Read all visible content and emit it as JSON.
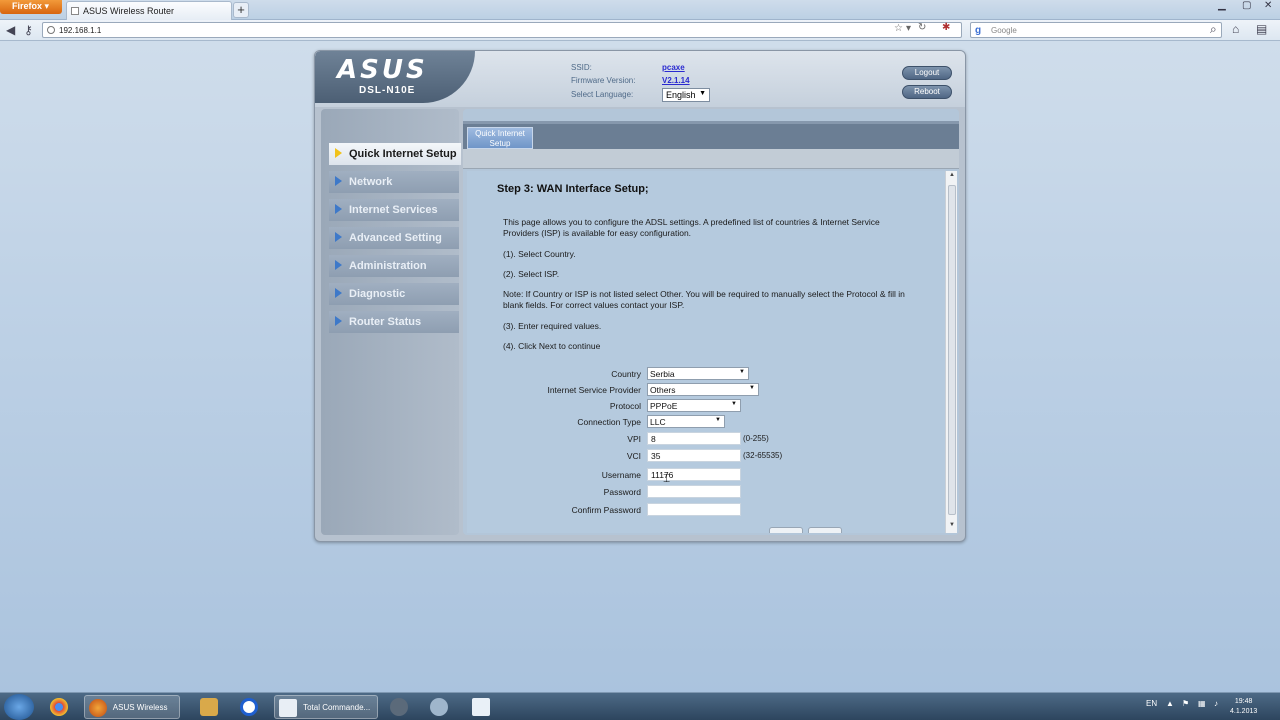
{
  "browser": {
    "app_button": "Firefox",
    "tab_title": "ASUS Wireless Router",
    "new_tab": "+",
    "url": "192.168.1.1",
    "search_placeholder": "Google"
  },
  "router": {
    "brand": "ASUS",
    "model": "DSL-N10E",
    "ssid_label": "SSID:",
    "ssid_value": "pcaxe",
    "firmware_label": "Firmware Version:",
    "firmware_value": "V2.1.14",
    "language_label": "Select Language:",
    "language_value": "English",
    "logout": "Logout",
    "reboot": "Reboot"
  },
  "sidebar": {
    "items": [
      {
        "label": "Quick Internet Setup"
      },
      {
        "label": "Network"
      },
      {
        "label": "Internet Services"
      },
      {
        "label": "Advanced Setting"
      },
      {
        "label": "Administration"
      },
      {
        "label": "Diagnostic"
      },
      {
        "label": "Router Status"
      }
    ]
  },
  "main": {
    "tab_line1": "Quick Internet",
    "tab_line2": "Setup",
    "step_title": "Step 3: WAN Interface Setup;",
    "intro": "This page allows you to configure the ADSL settings. A predefined list of countries & Internet Service Providers (ISP) is available for easy configuration.",
    "step1": "(1). Select Country.",
    "step2": "(2). Select ISP.",
    "note": "Note: If Country or ISP is not listed select Other. You will be required to manually select the Protocol & fill in blank fields. For correct values contact your ISP.",
    "step3": "(3). Enter required values.",
    "step4": "(4). Click Next to continue"
  },
  "form": {
    "country_label": "Country",
    "country_value": "Serbia",
    "isp_label": "Internet Service Provider",
    "isp_value": "Others",
    "protocol_label": "Protocol",
    "protocol_value": "PPPoE",
    "conn_label": "Connection Type",
    "conn_value": "LLC",
    "vpi_label": "VPI",
    "vpi_value": "8",
    "vpi_hint": "(0-255)",
    "vci_label": "VCI",
    "vci_value": "35",
    "vci_hint": "(32-65535)",
    "username_label": "Username",
    "username_value": "11176",
    "password_label": "Password",
    "password_value": "",
    "confirm_label": "Confirm Password",
    "confirm_value": ""
  },
  "taskbar": {
    "firefox_item": "ASUS Wireless Ro...",
    "tc_item": "Total Commande...",
    "lang": "EN",
    "time": "19:48",
    "date": "4.1.2013"
  }
}
